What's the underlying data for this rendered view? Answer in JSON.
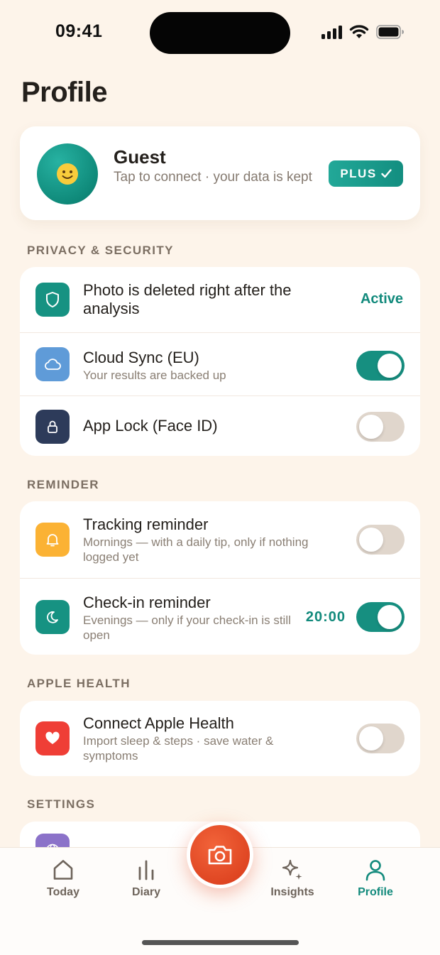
{
  "status_bar": {
    "time": "09:41"
  },
  "page": {
    "title": "Profile"
  },
  "profile": {
    "name": "Guest",
    "subtitle": "Tap to connect · your data is kept",
    "badge": "PLUS",
    "avatar_icon": "smiley-face-icon"
  },
  "privacy": {
    "header": "PRIVACY & SECURITY",
    "photo_deleted": {
      "title": "Photo is deleted right after the analysis",
      "status": "Active",
      "icon": "shield-icon"
    },
    "cloud_sync": {
      "title": "Cloud Sync (EU)",
      "subtitle": "Your results are backed up",
      "enabled": true,
      "icon": "cloud-icon"
    },
    "app_lock": {
      "title": "App Lock (Face ID)",
      "enabled": false,
      "icon": "lock-icon"
    }
  },
  "reminder": {
    "header": "REMINDER",
    "tracking": {
      "title": "Tracking reminder",
      "subtitle": "Mornings — with a daily tip, only if nothing logged yet",
      "enabled": false,
      "icon": "bell-icon"
    },
    "checkin": {
      "title": "Check-in reminder",
      "subtitle": "Evenings — only if your check-in is still open",
      "time": "20:00",
      "enabled": true,
      "icon": "moon-icon"
    }
  },
  "apple_health": {
    "header": "APPLE HEALTH",
    "connect": {
      "title": "Connect Apple Health",
      "subtitle": "Import sleep & steps · save water & symptoms",
      "enabled": false,
      "icon": "heart-icon"
    }
  },
  "settings": {
    "header": "SETTINGS"
  },
  "tab_bar": {
    "today": "Today",
    "diary": "Diary",
    "insights": "Insights",
    "profile": "Profile",
    "active": "profile"
  },
  "colors": {
    "accent": "#128a7c",
    "background": "#fdf4ea",
    "camera": "#e2492a"
  }
}
